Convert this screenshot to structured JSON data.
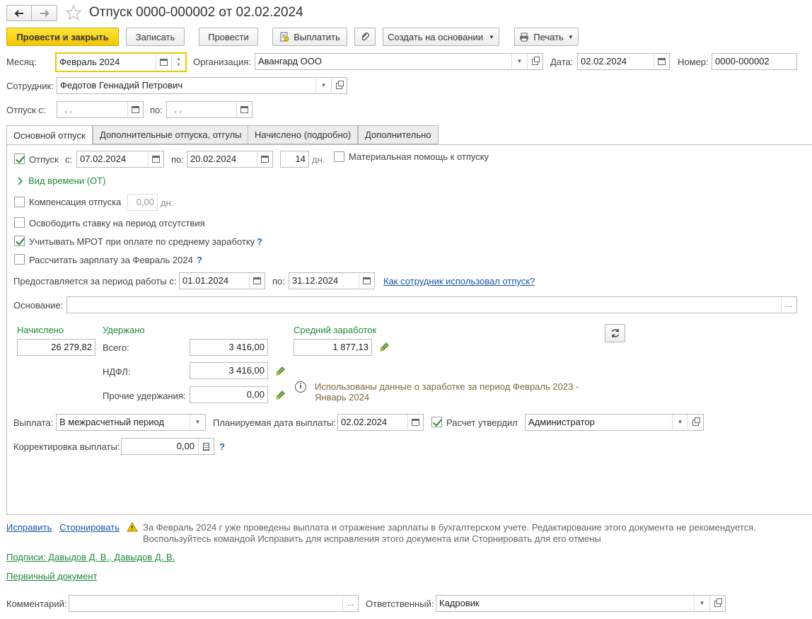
{
  "title": "Отпуск 0000-000002 от 02.02.2024",
  "toolbar": {
    "post_close": "Провести и закрыть",
    "save": "Записать",
    "post": "Провести",
    "pay": "Выплатить",
    "create_based": "Создать на основании",
    "print": "Печать"
  },
  "header": {
    "month_label": "Месяц:",
    "month_value": "Февраль 2024",
    "org_label": "Организация:",
    "org_value": "Авангард ООО",
    "date_label": "Дата:",
    "date_value": "02.02.2024",
    "number_label": "Номер:",
    "number_value": "0000-000002",
    "employee_label": "Сотрудник:",
    "employee_value": "Федотов Геннадий Петрович",
    "leave_from_label": "Отпуск с:",
    "leave_from_value": " .  .",
    "leave_to_label": "по:",
    "leave_to_value": " .  ."
  },
  "tabs": [
    {
      "label": "Основной отпуск"
    },
    {
      "label": "Дополнительные отпуска, отгулы"
    },
    {
      "label": "Начислено (подробно)"
    },
    {
      "label": "Дополнительно"
    }
  ],
  "main": {
    "leave_label": "Отпуск",
    "leave_from_label": "с:",
    "leave_from": "07.02.2024",
    "leave_to_label": "по:",
    "leave_to": "20.02.2024",
    "days": "14",
    "days_unit": "дн.",
    "material_help": "Материальная помощь к отпуску",
    "time_type": "Вид времени (ОТ)",
    "compensation_label": "Компенсация отпуска",
    "compensation_value": "0,00",
    "compensation_unit": "дн.",
    "release_rate": "Освободить ставку на период отсутствия",
    "mrot": "Учитывать МРОТ при оплате по среднему заработку",
    "calc_salary": "Рассчитать зарплату за Февраль 2024",
    "period_label": "Предоставляется за период работы с:",
    "period_from": "01.01.2024",
    "period_to_label": "по:",
    "period_to": "31.12.2024",
    "usage_link": "Как сотрудник использовал отпуск?",
    "basis_label": "Основание:",
    "basis_value": "",
    "accrued_label": "Начислено",
    "accrued_value": "26 279,82",
    "withheld_label": "Удержано",
    "total_label": "Всего:",
    "total_value": "3 416,00",
    "ndfl_label": "НДФЛ:",
    "ndfl_value": "3 416,00",
    "other_label": "Прочие удержания:",
    "other_value": "0,00",
    "avg_label": "Средний заработок",
    "avg_value": "1 877,13",
    "info_text_1": "Использованы данные о заработке за период Февраль 2023 -",
    "info_text_2": "Январь 2024",
    "payment_label": "Выплата:",
    "payment_value": "В межрасчетный период",
    "planned_date_label": "Планируемая дата выплаты:",
    "planned_date_value": "02.02.2024",
    "approved_label": "Расчет утвердил",
    "approved_value": "Администратор",
    "correction_label": "Корректировка выплаты:",
    "correction_value": "0,00"
  },
  "footer": {
    "fix_link": "Исправить",
    "reverse_link": "Сторнировать",
    "warning_1": "За Февраль 2024 г уже проведены выплата и отражение зарплаты в бухгалтерском учете. Редактирование этого документа не рекомендуется.",
    "warning_2": "Воспользуйтесь командой Исправить для исправления этого документа или Сторнировать для его отмены",
    "signatures_link": "Подписи: Давыдов Д. В., Давыдов Д. В.",
    "primary_doc_link": "Первичный документ",
    "comment_label": "Комментарий:",
    "comment_value": "",
    "responsible_label": "Ответственный:",
    "responsible_value": "Кадровик"
  },
  "colors": {
    "accent_yellow": "#f2c600",
    "link_blue": "#1a55a6",
    "link_green": "#1e8a3c",
    "check_green": "#2b8a3e"
  }
}
